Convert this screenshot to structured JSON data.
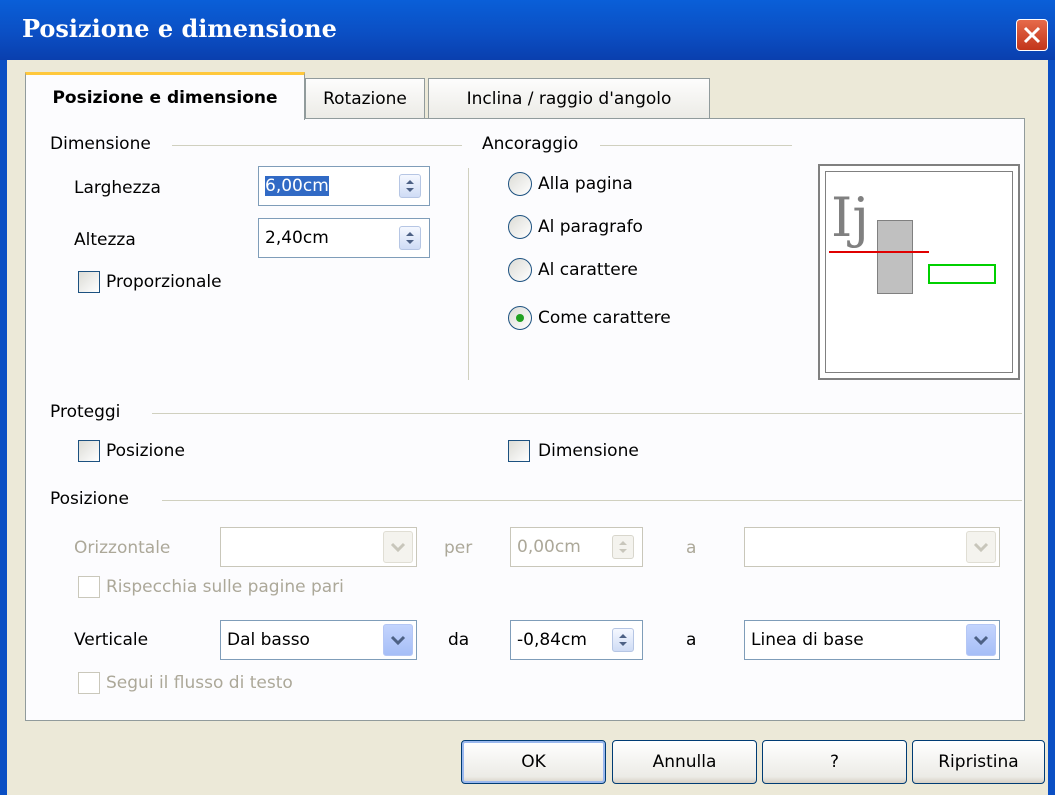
{
  "window": {
    "title": "Posizione e dimensione"
  },
  "tabs": [
    {
      "label": "Posizione e dimensione",
      "active": true
    },
    {
      "label": "Rotazione",
      "active": false
    },
    {
      "label": "Inclina / raggio d'angolo",
      "active": false
    }
  ],
  "dimensione": {
    "title": "Dimensione",
    "larghezza_label": "Larghezza",
    "larghezza_value": "6,00cm",
    "altezza_label": "Altezza",
    "altezza_value": "2,40cm",
    "proporzionale_label": "Proporzionale",
    "proporzionale_checked": false
  },
  "ancoraggio": {
    "title": "Ancoraggio",
    "options": [
      {
        "label": "Alla pagina",
        "selected": false
      },
      {
        "label": "Al paragrafo",
        "selected": false
      },
      {
        "label": "Al carattere",
        "selected": false
      },
      {
        "label": "Come carattere",
        "selected": true
      }
    ],
    "preview_text": "Ij"
  },
  "proteggi": {
    "title": "Proteggi",
    "posizione_label": "Posizione",
    "dimensione_label": "Dimensione"
  },
  "posizione": {
    "title": "Posizione",
    "orizzontale_label": "Orizzontale",
    "orizzontale_value": "",
    "per_label": "per",
    "per_value": "0,00cm",
    "a_label": "a",
    "a_value": "",
    "rispecchia_label": "Rispecchia sulle pagine pari",
    "verticale_label": "Verticale",
    "verticale_value": "Dal basso",
    "da_label": "da",
    "da_value": "-0,84cm",
    "a2_label": "a",
    "a2_value": "Linea di base",
    "segui_label": "Segui il flusso di testo"
  },
  "buttons": {
    "ok": "OK",
    "annulla": "Annulla",
    "help": "?",
    "ripristina": "Ripristina"
  },
  "colors": {
    "title_bar": "#0b4fc4",
    "tab_highlight": "#ffc83c",
    "preview_baseline": "#e00000",
    "preview_frame": "#00d000",
    "radio_dot": "#21a121"
  }
}
